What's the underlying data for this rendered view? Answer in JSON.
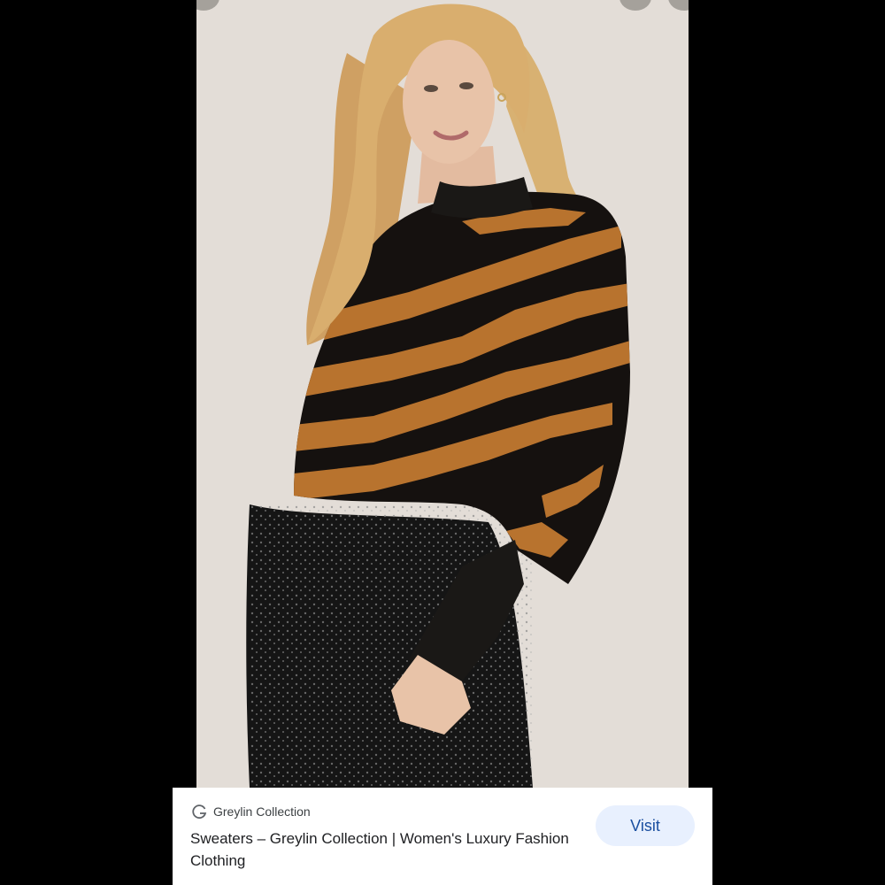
{
  "image": {
    "description_icon": "product-photo",
    "colors": {
      "background": "#e6e1db",
      "sweater_orange": "#b8732e",
      "sweater_black": "#15110f",
      "hair": "#d9ae6e",
      "skin": "#e8c3a8",
      "pants": "#151515"
    }
  },
  "result": {
    "source_icon": "g-icon",
    "source_name": "Greylin Collection",
    "title": "Sweaters – Greylin Collection | Women's Luxury Fashion Clothing",
    "visit_label": "Visit",
    "accent": "#e8f0fe"
  }
}
